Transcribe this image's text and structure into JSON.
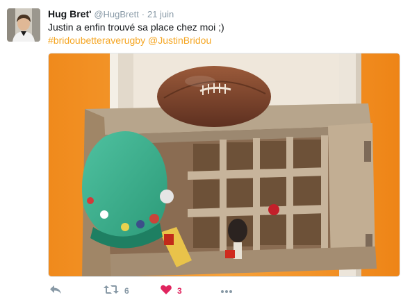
{
  "tweet": {
    "display_name": "Hug Bret'",
    "handle": "@HugBrett",
    "separator": "·",
    "date": "21 juin",
    "text": "Justin a enfin trouvé sa place chez moi ;)",
    "hashtag": "#bridoubetteraverugby",
    "mention": "@JustinBridou"
  },
  "actions": {
    "reply_icon": "reply-arrow-icon",
    "retweet_icon": "retweet-icon",
    "retweet_count": "6",
    "like_icon": "heart-icon",
    "like_count": "3",
    "more_icon": "ellipsis-icon"
  },
  "colors": {
    "hashtag": "#f5a623",
    "like_active": "#e0245e",
    "muted": "#8899a6",
    "text": "#14171a"
  }
}
